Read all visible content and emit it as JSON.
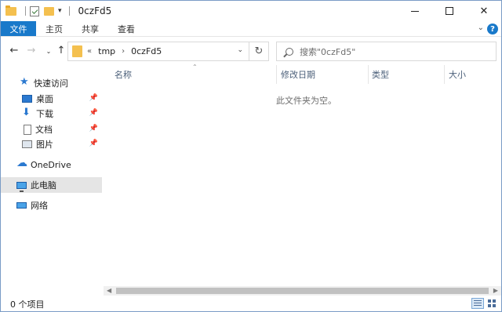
{
  "window": {
    "title": "0czFd5",
    "qat_dropdown": "▾",
    "min_glyph": "",
    "close_glyph": "✕"
  },
  "ribbon": {
    "tabs": [
      "文件",
      "主页",
      "共享",
      "查看"
    ],
    "expand_glyph": "⌄",
    "help_glyph": "?"
  },
  "nav": {
    "back": "←",
    "forward": "→",
    "recent": "⌄",
    "up": "↑",
    "breadcrumb": [
      "«",
      "tmp",
      "›",
      "0czFd5"
    ],
    "address_dropdown": "⌄",
    "refresh": "↻",
    "search_placeholder": "搜索\"0czFd5\""
  },
  "sidebar": {
    "items": [
      {
        "label": "快速访问",
        "icon": "star-icon"
      },
      {
        "label": "桌面",
        "icon": "desktop-icon",
        "pinned": true
      },
      {
        "label": "下载",
        "icon": "download-icon",
        "pinned": true
      },
      {
        "label": "文档",
        "icon": "document-icon",
        "pinned": true
      },
      {
        "label": "图片",
        "icon": "pictures-icon",
        "pinned": true
      },
      {
        "label": "OneDrive",
        "icon": "cloud-icon"
      },
      {
        "label": "此电脑",
        "icon": "computer-icon",
        "selected": true
      },
      {
        "label": "网络",
        "icon": "network-icon"
      }
    ],
    "pin_glyph": "📌"
  },
  "columns": [
    "名称",
    "修改日期",
    "类型",
    "大小"
  ],
  "sort_glyph": "⌃",
  "empty_message": "此文件夹为空。",
  "scrollbar": {
    "left": "◀",
    "right": "▶"
  },
  "status": {
    "item_count": "0 个项目"
  }
}
